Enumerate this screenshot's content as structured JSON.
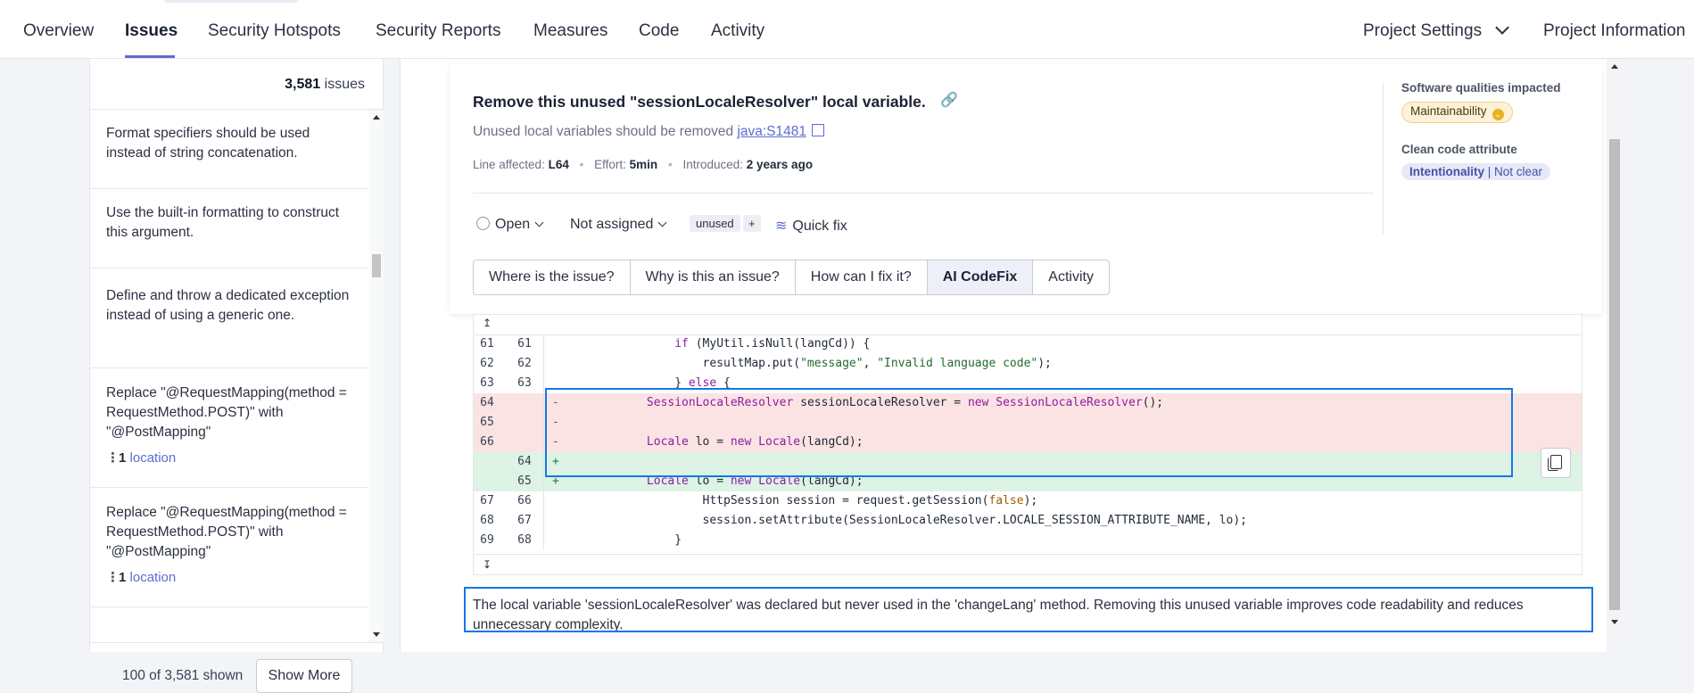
{
  "nav": {
    "tabs": [
      "Overview",
      "Issues",
      "Security Hotspots",
      "Security Reports",
      "Measures",
      "Code",
      "Activity"
    ],
    "active_tab": "Issues",
    "project_settings": "Project Settings",
    "project_information": "Project Information"
  },
  "issue_list": {
    "count_value": "3,581",
    "count_suffix": "issues",
    "items": [
      {
        "message": "Format specifiers should be used instead of string concatenation."
      },
      {
        "message": "Use the built-in formatting to construct this argument."
      },
      {
        "message": "Define and throw a dedicated exception instead of using a generic one."
      },
      {
        "message": "Replace \"@RequestMapping(method = RequestMethod.POST)\" with \"@PostMapping\"",
        "location_count": "1",
        "location_label": "location"
      },
      {
        "message": "Replace \"@RequestMapping(method = RequestMethod.POST)\" with \"@PostMapping\"",
        "location_count": "1",
        "location_label": "location"
      }
    ],
    "shown_text": "100 of 3,581 shown",
    "show_more_label": "Show More"
  },
  "issue": {
    "title": "Remove this unused \"sessionLocaleResolver\" local variable.",
    "rule_text": "Unused local variables should be removed",
    "rule_key": "java:S1481",
    "line_affected_label": "Line affected:",
    "line_affected_value": "L64",
    "effort_label": "Effort:",
    "effort_value": "5min",
    "introduced_label": "Introduced:",
    "introduced_value": "2 years ago",
    "status": "Open",
    "assignee": "Not assigned",
    "tag": "unused",
    "tag_add": "+",
    "quick_fix": "Quick fix",
    "qualities_label": "Software qualities impacted",
    "quality_badge": "Maintainability",
    "clean_code_label": "Clean code attribute",
    "clean_code_primary": "Intentionality",
    "clean_code_secondary": "Not clear"
  },
  "tabs": [
    "Where is the issue?",
    "Why is this an issue?",
    "How can I fix it?",
    "AI CodeFix",
    "Activity"
  ],
  "active_detail_tab": "AI CodeFix",
  "diff": [
    {
      "old": "61",
      "new": "61",
      "type": "ctx",
      "code": "                if (MyUtil.isNull(langCd)) {"
    },
    {
      "old": "62",
      "new": "62",
      "type": "ctx",
      "code": "                    resultMap.put(\"message\", \"Invalid language code\");"
    },
    {
      "old": "63",
      "new": "63",
      "type": "ctx",
      "code": "                } else {"
    },
    {
      "old": "64",
      "new": "",
      "type": "del",
      "code": "            SessionLocaleResolver sessionLocaleResolver = new SessionLocaleResolver();"
    },
    {
      "old": "65",
      "new": "",
      "type": "del",
      "code": ""
    },
    {
      "old": "66",
      "new": "",
      "type": "del",
      "code": "            Locale lo = new Locale(langCd);"
    },
    {
      "old": "",
      "new": "64",
      "type": "add",
      "code": ""
    },
    {
      "old": "",
      "new": "65",
      "type": "add",
      "code": "            Locale lo = new Locale(langCd);"
    },
    {
      "old": "67",
      "new": "66",
      "type": "ctx",
      "code": "                    HttpSession session = request.getSession(false);"
    },
    {
      "old": "68",
      "new": "67",
      "type": "ctx",
      "code": "                    session.setAttribute(SessionLocaleResolver.LOCALE_SESSION_ATTRIBUTE_NAME, lo);"
    },
    {
      "old": "69",
      "new": "68",
      "type": "ctx",
      "code": "                }"
    }
  ],
  "diff_markers": {
    "del": "-",
    "add": "+"
  },
  "explanation": "The local variable 'sessionLocaleResolver' was declared but never used in the 'changeLang' method. Removing this unused variable improves code readability and reduces unnecessary complexity.",
  "icons": {
    "link": "link-icon",
    "external": "external-link-icon",
    "copy": "copy-icon",
    "quick_fix": "quick-fix-icon",
    "expand_up": "expand-up-icon",
    "expand_down": "expand-down-icon"
  },
  "colors": {
    "accent": "#5d6cd1",
    "highlight_border": "#1677e6",
    "deleted_bg": "#fbe3e3",
    "added_bg": "#ddf3e6",
    "maintainability": "#e6b325"
  }
}
